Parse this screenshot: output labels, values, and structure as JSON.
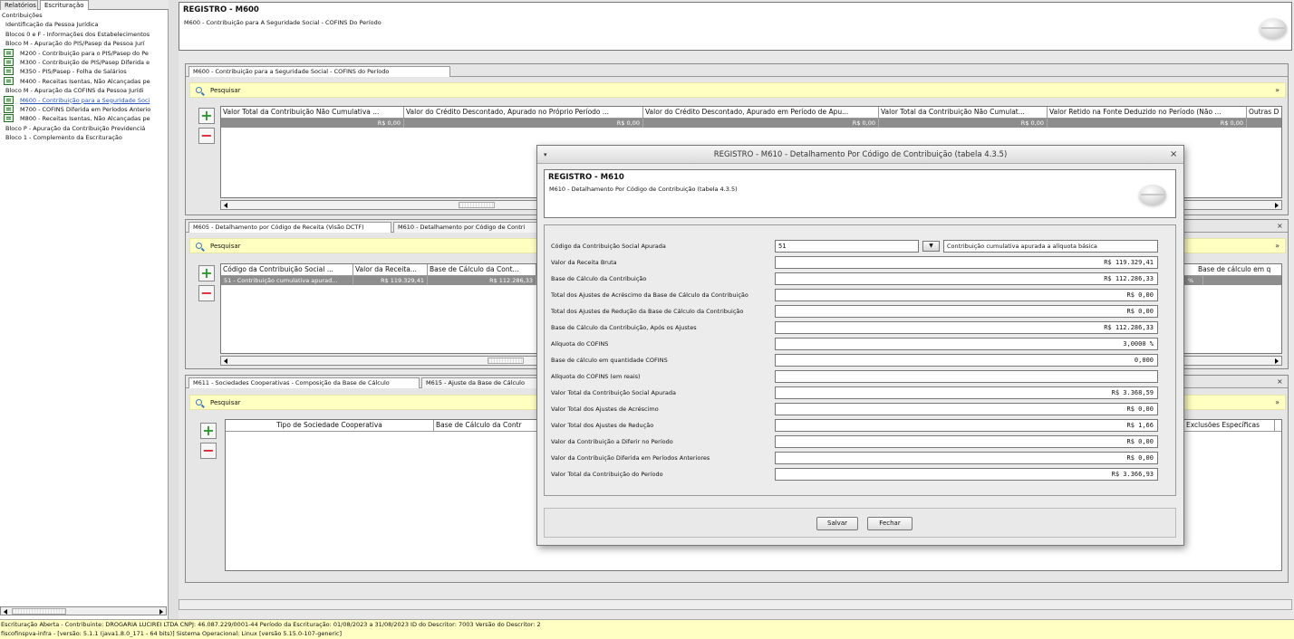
{
  "left": {
    "tabs": [
      "Relatórios",
      "Escrituração"
    ],
    "tree": [
      {
        "label": "Contribuições",
        "indent": 0,
        "icon": false
      },
      {
        "label": "Identificação da Pessoa Jurídica",
        "indent": 1,
        "icon": false
      },
      {
        "label": "Blocos 0 e F - Informações dos Estabelecimentos",
        "indent": 1,
        "icon": false
      },
      {
        "label": "Bloco M - Apuração do PIS/Pasep da Pessoa Jurí",
        "indent": 1,
        "icon": false
      },
      {
        "label": "M200 - Contribuição para o PIS/Pasep do Pe",
        "indent": 2,
        "icon": true
      },
      {
        "label": "M300 - Contribuição de PIS/Pasep Diferida e",
        "indent": 2,
        "icon": true
      },
      {
        "label": "M350 - PIS/Pasep - Folha de Salários",
        "indent": 2,
        "icon": true
      },
      {
        "label": "M400 - Receitas Isentas, Não Alcançadas pe",
        "indent": 2,
        "icon": true
      },
      {
        "label": "Bloco M - Apuração da COFINS da Pessoa Jurídi",
        "indent": 1,
        "icon": false
      },
      {
        "label": "M600 - Contribuição para a Seguridade Soci",
        "indent": 2,
        "icon": true,
        "selected": true
      },
      {
        "label": "M700 - COFINS Diferida em Períodos Anterio",
        "indent": 2,
        "icon": true
      },
      {
        "label": "M800 - Receitas Isentas, Não Alcançadas pe",
        "indent": 2,
        "icon": true
      },
      {
        "label": "Bloco P - Apuração da Contribuição Previdenciá",
        "indent": 1,
        "icon": false
      },
      {
        "label": "Bloco 1 - Complemento da Escrituração",
        "indent": 1,
        "icon": false
      }
    ]
  },
  "header": {
    "title": "REGISTRO - M600",
    "subtitle": "M600 - Contribuição para A Seguridade Social - COFINS Do Período"
  },
  "panel1": {
    "tab": "M600 - Contribuição para a Seguridade Social - COFINS do Período",
    "search": "Pesquisar",
    "columns": [
      "Valor Total da Contribuição Não Cumulativa ...",
      "Valor do Crédito Descontado, Apurado no Próprio Período ...",
      "Valor do Crédito Descontado, Apurado em Período de Apu...",
      "Valor Total da Contribuição Não Cumulat...",
      "Valor Retido na Fonte Deduzido no Período (Não ...",
      "Outras D"
    ],
    "row": [
      "R$ 0,00",
      "R$ 0,00",
      "R$ 0,00",
      "R$ 0,00",
      "R$ 0,00",
      ""
    ]
  },
  "panel2": {
    "tabs": [
      "M605 - Detalhamento por Código de Receita (Visão DCTF)",
      "M610 - Detalhamento por Código de Contri"
    ],
    "search": "Pesquisar",
    "columns": [
      "Código da Contribuição Social ...",
      "Valor da Receita...",
      "Base de Cálculo da Cont..."
    ],
    "row": [
      "51 - Contribuição cumulativa apurad...",
      "R$ 119.329,41",
      "R$ 112.286,33"
    ],
    "right_column": "Base de cálculo em q",
    "right_cell": "%"
  },
  "panel3": {
    "tabs": [
      "M611 - Sociedades Cooperativas - Composição da Base de Cálculo",
      "M615 - Ajuste da Base de Cálculo"
    ],
    "search": "Pesquisar",
    "columns": [
      "Tipo de Sociedade Cooperativa",
      "Base de Cálculo da Contr"
    ],
    "right_column": "Exclusões Específicas"
  },
  "dialog": {
    "title": "REGISTRO - M610 - Detalhamento Por Código de Contribuição (tabela 4.3.5)",
    "header_title": "REGISTRO - M610",
    "header_subtitle": "M610 - Detalhamento Por Código de Contribuição (tabela 4.3.5)",
    "code_label": "Código da Contribuição Social Apurada",
    "code_value": "51",
    "code_description": "Contribuição cumulativa apurada a alíquota básica",
    "fields": [
      {
        "label": "Valor da Receita Bruta",
        "value": "R$ 119.329,41"
      },
      {
        "label": "Base de Cálculo da Contribuição",
        "value": "R$ 112.286,33"
      },
      {
        "label": "Total dos Ajustes de Acréscimo da Base de Cálculo da Contribuição",
        "value": "R$ 0,00"
      },
      {
        "label": "Total dos Ajustes de Redução da Base de Cálculo da Contribuição",
        "value": "R$ 0,00"
      },
      {
        "label": "Base de Cálculo da Contribuição, Após os Ajustes",
        "value": "R$ 112.286,33"
      },
      {
        "label": "Alíquota do COFINS",
        "value": "3,0000 %"
      },
      {
        "label": "Base de cálculo em quantidade COFINS",
        "value": "0,000"
      },
      {
        "label": "Alíquota do COFINS (em reais)",
        "value": ""
      },
      {
        "label": "Valor Total da Contribuição Social Apurada",
        "value": "R$ 3.368,59"
      },
      {
        "label": "Valor Total dos Ajustes de Acréscimo",
        "value": "R$ 0,00"
      },
      {
        "label": "Valor Total dos Ajustes de Redução",
        "value": "R$ 1,66"
      },
      {
        "label": "Valor da Contribuição a Diferir no Período",
        "value": "R$ 0,00"
      },
      {
        "label": "Valor da Contribuição Diferida em Períodos Anteriores",
        "value": "R$ 0,00"
      },
      {
        "label": "Valor Total da Contribuição do Período",
        "value": "R$ 3.366,93"
      }
    ],
    "save_label": "Salvar",
    "close_label": "Fechar"
  },
  "status": {
    "line1": "Escrituração Aberta - Contribuinte: DROGARIA LUCIREI LTDA CNPJ: 46.087.229/0001-44 Período da Escrituração: 01/08/2023 a 31/08/2023 ID do Descritor: 7003 Versão do Descritor: 2",
    "line2": "fiscofinspva-infra - [versão: 5.1.1 (java1.8.0_171 - 64 bits)] Sistema Operacional: Linux [versão 5.15.0-107-generic]"
  }
}
